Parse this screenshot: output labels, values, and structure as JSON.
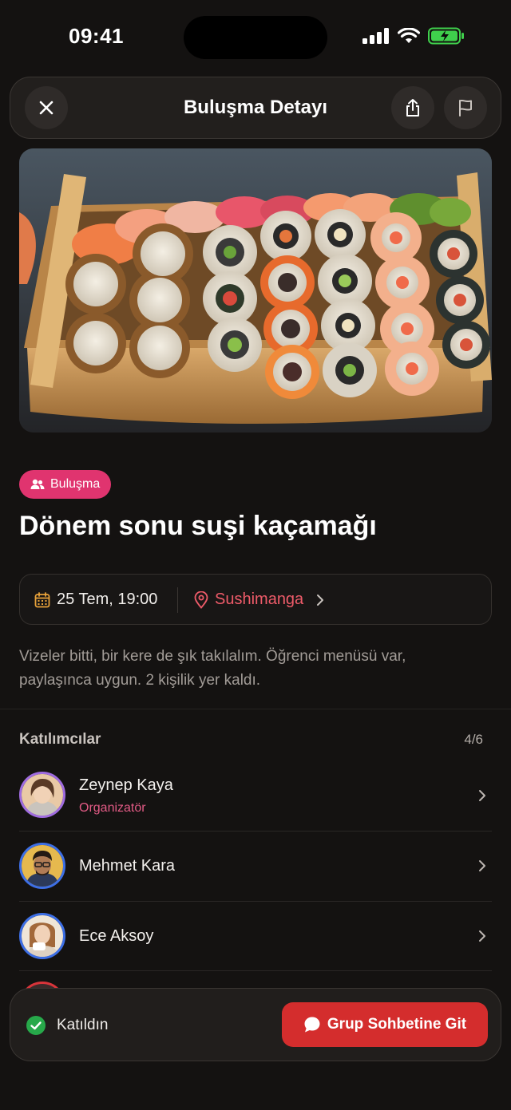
{
  "status_bar": {
    "time": "09:41"
  },
  "header": {
    "title": "Buluşma Detayı"
  },
  "event": {
    "tag": "Buluşma",
    "title": "Dönem sonu suşi kaçamağı",
    "date": "25 Tem, 19:00",
    "location": "Sushimanga",
    "description": "Vizeler bitti, bir kere de şık takılalım. Öğrenci menüsü var, paylaşınca uygun. 2 kişilik yer kaldı."
  },
  "participants": {
    "title": "Katılımcılar",
    "count": "4/6",
    "items": [
      {
        "name": "Zeynep Kaya",
        "role": "Organizatör"
      },
      {
        "name": "Mehmet Kara",
        "role": ""
      },
      {
        "name": "Ece Aksoy",
        "role": ""
      }
    ]
  },
  "bottom_bar": {
    "status": "Katıldın",
    "cta": "Grup Sohbetine Git"
  },
  "colors": {
    "accent_pink": "#e0346f",
    "accent_red": "#d42d2d",
    "location": "#ee5b69",
    "joined_green": "#27a94a"
  }
}
